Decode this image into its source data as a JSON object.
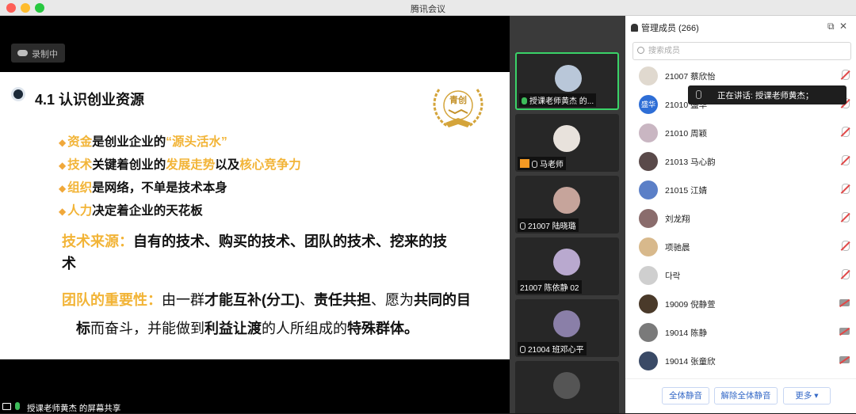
{
  "window": {
    "title": "腾讯会议"
  },
  "recording": {
    "label": "录制中"
  },
  "slide": {
    "heading": "4.1 认识创业资源",
    "logo_text": "青创",
    "bullet_lines": [
      {
        "marker": "◆",
        "a": "资金",
        "b": "是创业企业的",
        "c": "“源头活水”"
      },
      {
        "marker": "◆",
        "a": "技术",
        "b": "关键着创业的",
        "c": "发展走势",
        "d": "以及",
        "e": "核心竞争力"
      },
      {
        "marker": "◆",
        "a": "组织",
        "b": "是网络，不单是技术本身"
      },
      {
        "marker": "◆",
        "a": "人力",
        "b": "决定着企业的天花板"
      }
    ],
    "tech_label": "技术来源：",
    "tech_text1": "自有的技术、购买的技术、团队的技术、挖来的技",
    "tech_text2": "术",
    "team_label": "团队的重要性：",
    "team_p1": "由一群",
    "team_p2": "才能互补(分工)",
    "team_p3": "、",
    "team_p4": "责任共担",
    "team_p5": "、愿为",
    "team_p6": "共同的目",
    "team_p7": "标",
    "team_p8": "而奋斗，并能做到",
    "team_p9": "利益让渡",
    "team_p10": "的人所组成的",
    "team_p11": "特殊群体。"
  },
  "screen_share": {
    "label": "授课老师黄杰 的屏幕共享"
  },
  "video_tiles": [
    {
      "name": "授课老师黄杰 的...",
      "active": true,
      "avatar_color": "#b9c7d9"
    },
    {
      "name": "马老师",
      "host": true,
      "avatar_color": "#e8e2dc"
    },
    {
      "name": "21007 陆晓璐",
      "avatar_color": "#c6a49b"
    },
    {
      "name": "21007 陈依静 02",
      "avatar_color": "#b9a9cf"
    },
    {
      "name": "21004 班邓心平",
      "avatar_color": "#8a7fa8"
    }
  ],
  "panel": {
    "title": "管理成员 (266)",
    "search_placeholder": "搜索成员",
    "members": [
      {
        "name": "21007 蔡欣怡",
        "status": "mic-off",
        "avatar_color": "#e0d9cf",
        "avatar_text": ""
      },
      {
        "name": "21010 盛华",
        "status": "mic-off",
        "avatar_color": "#2e6ed6",
        "avatar_text": "盛华"
      },
      {
        "name": "21010 周颖",
        "status": "mic-off",
        "avatar_color": "#c9b6c2",
        "avatar_text": ""
      },
      {
        "name": "21013 马心韵",
        "status": "mic-off",
        "avatar_color": "#5a4a4a",
        "avatar_text": ""
      },
      {
        "name": "21015 江婧",
        "status": "mic-off",
        "avatar_color": "#5b7fc7",
        "avatar_text": ""
      },
      {
        "name": "刘龙翔",
        "status": "mic-off",
        "avatar_color": "#8a6c6c",
        "avatar_text": ""
      },
      {
        "name": "项驰晨",
        "status": "mic-off",
        "avatar_color": "#d8b98c",
        "avatar_text": ""
      },
      {
        "name": "다락",
        "status": "mic-off",
        "avatar_color": "#cfcfcf",
        "avatar_text": ""
      },
      {
        "name": "19009 倪静萱",
        "status": "cam-off",
        "avatar_color": "#4a3a2a",
        "avatar_text": ""
      },
      {
        "name": "19014 陈静",
        "status": "cam-off",
        "avatar_color": "#7a7a7a",
        "avatar_text": ""
      },
      {
        "name": "19014 张童欣",
        "status": "cam-off",
        "avatar_color": "#3a4a66",
        "avatar_text": ""
      }
    ],
    "speaking_tooltip": "正在讲话: 授课老师黄杰；",
    "buttons": {
      "mute_all": "全体静音",
      "unmute_all": "解除全体静音",
      "more": "更多 ▾"
    }
  }
}
